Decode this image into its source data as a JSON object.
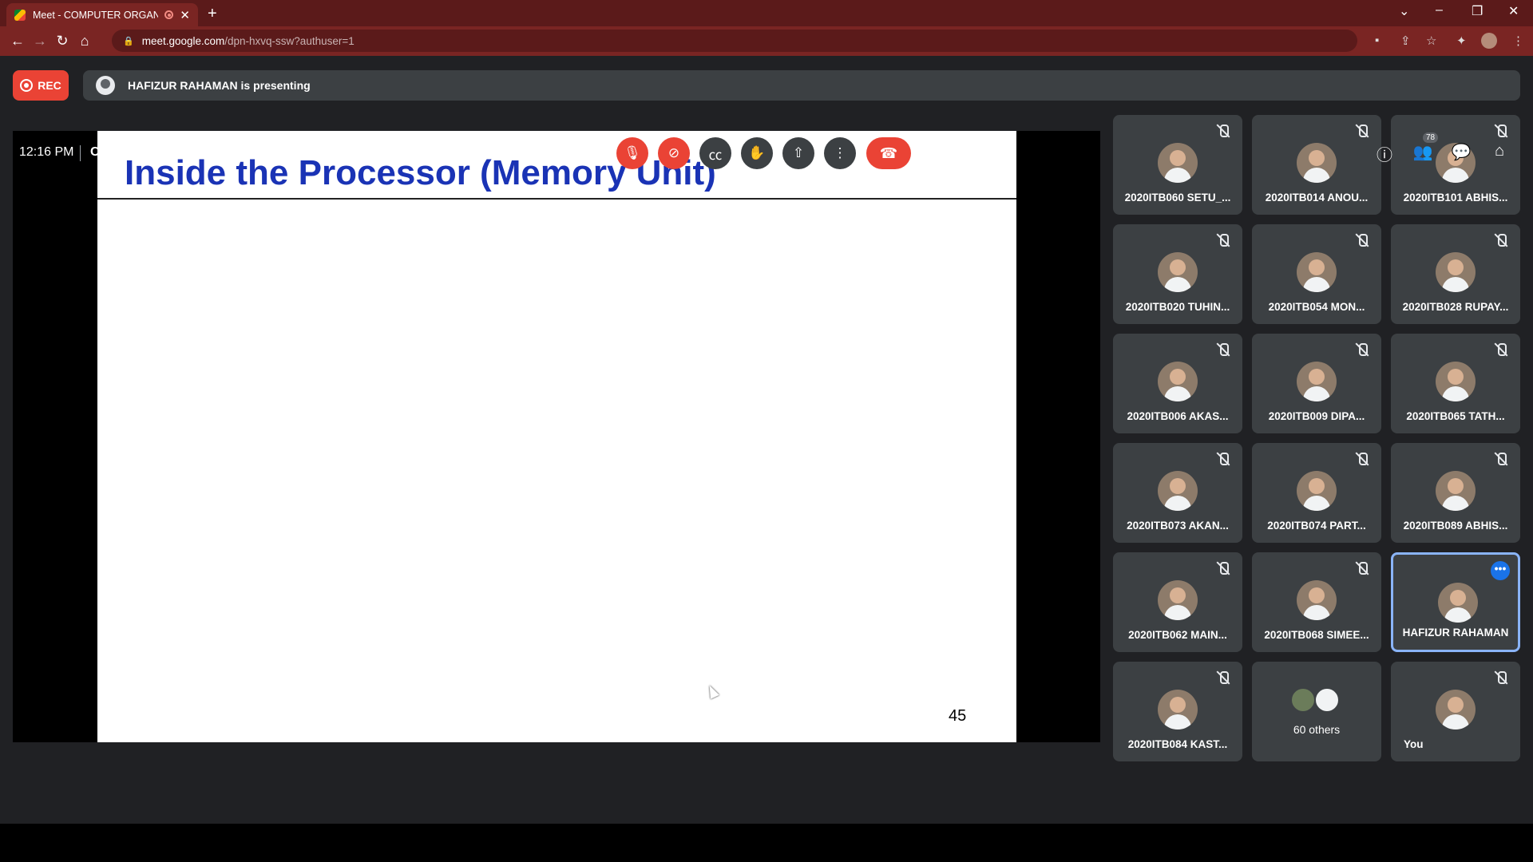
{
  "browser": {
    "tab_title": "Meet - COMPUTER ORGANIZ",
    "url_host": "meet.google.com",
    "url_path": "/dpn-hxvq-ssw?authuser=1"
  },
  "meet": {
    "rec_label": "REC",
    "presenting_text": "HAFIZUR RAHAMAN is presenting",
    "slide": {
      "title": "Inside the Processor (Memory Unit)",
      "page_number": "45"
    },
    "participants": [
      {
        "name": "2020ITB060 SETU_...",
        "muted": true
      },
      {
        "name": "2020ITB014 ANOU...",
        "muted": true
      },
      {
        "name": "2020ITB101 ABHIS...",
        "muted": true
      },
      {
        "name": "2020ITB020 TUHIN...",
        "muted": true
      },
      {
        "name": "2020ITB054 MON...",
        "muted": true
      },
      {
        "name": "2020ITB028 RUPAY...",
        "muted": true
      },
      {
        "name": "2020ITB006 AKAS...",
        "muted": true
      },
      {
        "name": "2020ITB009 DIPA...",
        "muted": true
      },
      {
        "name": "2020ITB065 TATH...",
        "muted": true
      },
      {
        "name": "2020ITB073 AKAN...",
        "muted": true
      },
      {
        "name": "2020ITB074 PART...",
        "muted": true
      },
      {
        "name": "2020ITB089 ABHIS...",
        "muted": true
      },
      {
        "name": "2020ITB062 MAIN...",
        "muted": true
      },
      {
        "name": "2020ITB068 SIMEE...",
        "muted": true
      },
      {
        "name": "HAFIZUR RAHAMAN",
        "muted": false,
        "active": true
      },
      {
        "name": "2020ITB084 KAST...",
        "muted": true
      },
      {
        "name": "60 others",
        "muted": false
      },
      {
        "name": "You",
        "muted": true
      }
    ],
    "bottom": {
      "time": "12:16 PM",
      "meeting_title": "COMPUTER ORGANIZATION AND ARCHITECTURE (I...",
      "people_count": "78"
    },
    "colors": {
      "accent_red": "#ea4335",
      "tile_bg": "#3c4043",
      "slide_title": "#1a33b5"
    }
  }
}
